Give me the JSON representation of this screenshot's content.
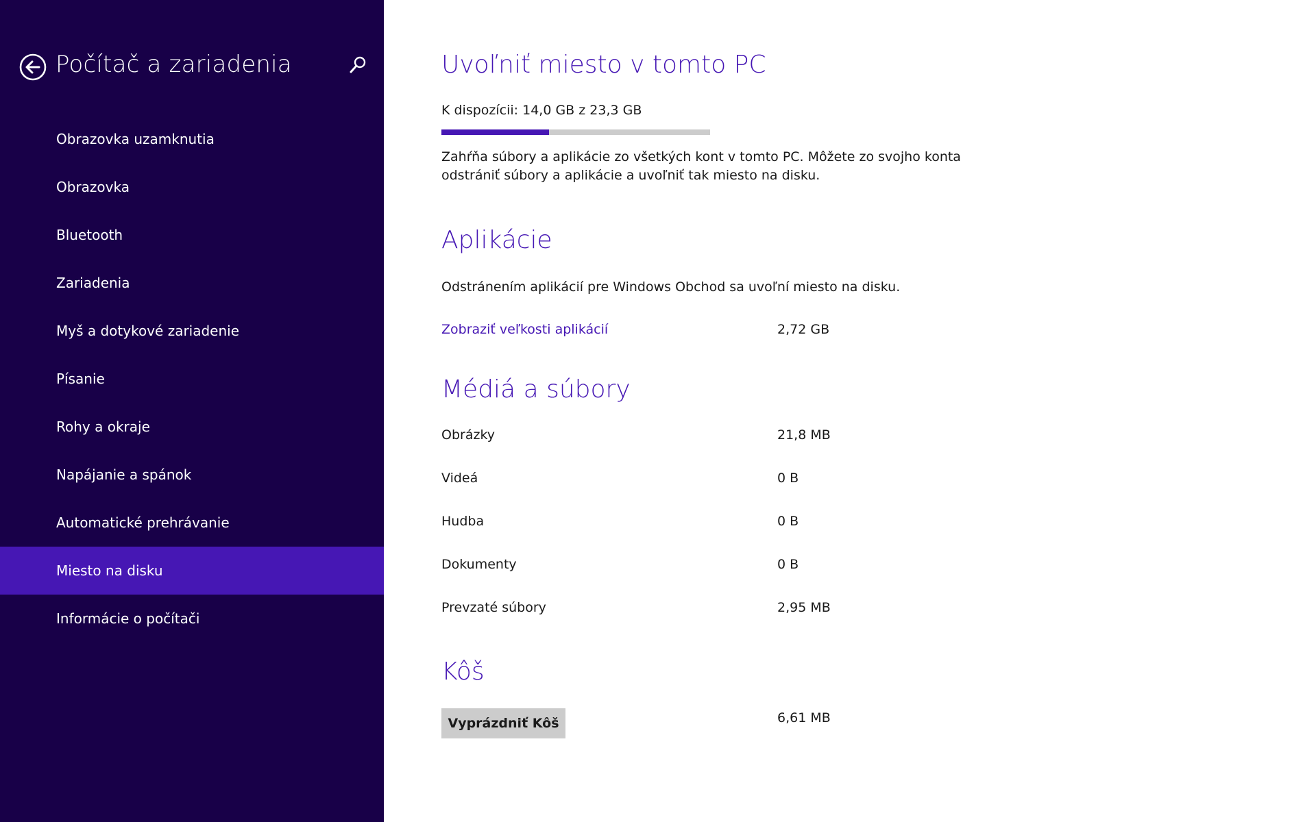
{
  "sidebar": {
    "title": "Počítač a zariadenia",
    "back_icon": "back-arrow-icon",
    "search_icon": "search-icon",
    "items": [
      {
        "label": "Obrazovka uzamknutia"
      },
      {
        "label": "Obrazovka"
      },
      {
        "label": "Bluetooth"
      },
      {
        "label": "Zariadenia"
      },
      {
        "label": "Myš a dotykové zariadenie"
      },
      {
        "label": "Písanie"
      },
      {
        "label": "Rohy a okraje"
      },
      {
        "label": "Napájanie a spánok"
      },
      {
        "label": "Automatické prehrávanie"
      },
      {
        "label": "Miesto na disku",
        "active": true
      },
      {
        "label": "Informácie o počítači"
      }
    ]
  },
  "main": {
    "title": "Uvoľniť miesto v tomto PC",
    "available": "K dispozícii: 14,0 GB z 23,3 GB",
    "usage_fraction": 0.4,
    "description": "Zahŕňa súbory a aplikácie zo všetkých kont v tomto PC. Môžete zo svojho konta odstrániť súbory a aplikácie a uvoľniť tak miesto na disku.",
    "apps": {
      "heading": "Aplikácie",
      "description": "Odstránením aplikácií pre Windows Obchod sa uvoľní miesto na disku.",
      "link_label": "Zobraziť veľkosti aplikácií",
      "size": "2,72 GB"
    },
    "media": {
      "heading": "Médiá a súbory",
      "rows": [
        {
          "label": "Obrázky",
          "value": "21,8 MB"
        },
        {
          "label": "Videá",
          "value": "0 B"
        },
        {
          "label": "Hudba",
          "value": "0 B"
        },
        {
          "label": "Dokumenty",
          "value": "0 B"
        },
        {
          "label": "Prevzaté súbory",
          "value": "2,95 MB"
        }
      ]
    },
    "recycle": {
      "heading": "Kôš",
      "button_label": "Vyprázdniť Kôš",
      "size": "6,61 MB"
    }
  },
  "colors": {
    "sidebar_bg": "#180048",
    "accent": "#4617b4",
    "progress_track": "#cccccc"
  }
}
